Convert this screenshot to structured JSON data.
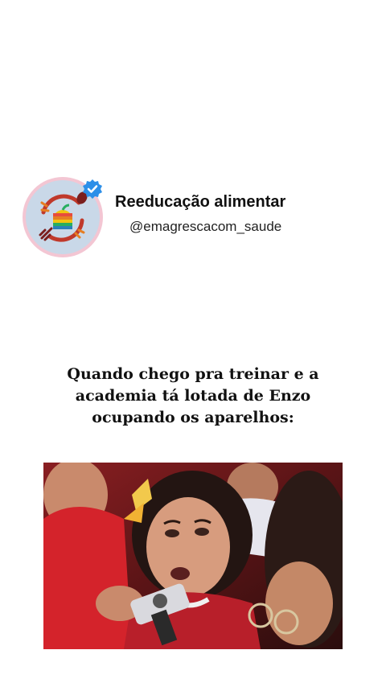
{
  "profile": {
    "name": "Reeducação alimentar",
    "handle": "@emagrescacom_saude",
    "verified_icon": "verified-badge-icon",
    "avatar_icon": "food-logo-icon"
  },
  "caption": {
    "lines": [
      "Quando chego pra treinar e a",
      "academia tá lotada de Enzo",
      "ocupando os aparelhos:"
    ]
  },
  "colors": {
    "verified": "#2d8fe8",
    "avatar_ring": "#f3c6d3",
    "avatar_bg": "#c9d8e8",
    "text": "#111111"
  }
}
